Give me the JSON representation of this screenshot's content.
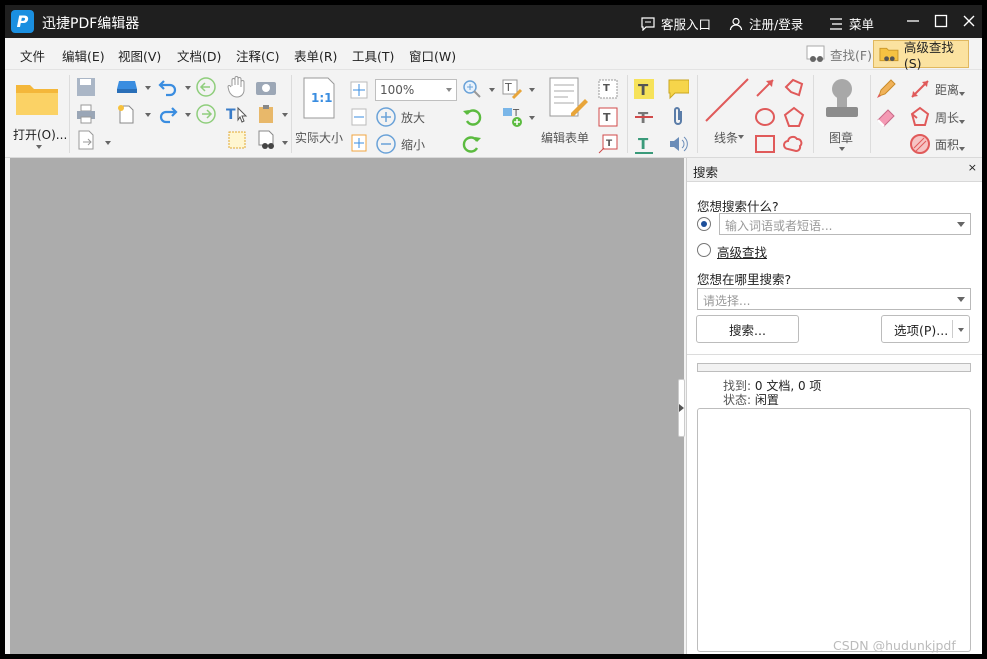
{
  "app": {
    "title": "迅捷PDF编辑器",
    "logo_letter": "P"
  },
  "titlebar": {
    "service": "客服入口",
    "login": "注册/登录",
    "menu": "菜单"
  },
  "menubar": {
    "items": [
      "文件",
      "编辑(E)",
      "视图(V)",
      "文档(D)",
      "注释(C)",
      "表单(R)",
      "工具(T)",
      "窗口(W)"
    ]
  },
  "quick": {
    "find": "查找(F)",
    "advanced_find": "高级查找(S)"
  },
  "toolbar": {
    "open": "打开(O)...",
    "actual_size": "实际大小",
    "actual_size_icon": "1:1",
    "zoom_value": "100%",
    "zoom_in": "放大",
    "zoom_out": "缩小",
    "edit_form": "编辑表单",
    "lines": "线条",
    "stamp": "图章",
    "distance": "距离",
    "perimeter": "周长",
    "area": "面积"
  },
  "search_panel": {
    "title": "搜索",
    "close": "×",
    "what_label": "您想搜索什么?",
    "term_placeholder": "输入词语或者短语...",
    "advanced_option": "高级查找",
    "where_label": "您想在哪里搜索?",
    "where_placeholder": "请选择...",
    "search_button": "搜索...",
    "options_button": "选项(P)...",
    "found_label": "找到:",
    "found_value": "0 文档, 0 项",
    "status_label": "状态:",
    "status_value": "闲置"
  },
  "watermark": "CSDN @hudunkjpdf",
  "colors": {
    "titlebar": "#1f1f1f",
    "accent": "#1a8fe0",
    "doc_bg": "#acacac",
    "advanced_find_bg": "#fbe2a0"
  }
}
